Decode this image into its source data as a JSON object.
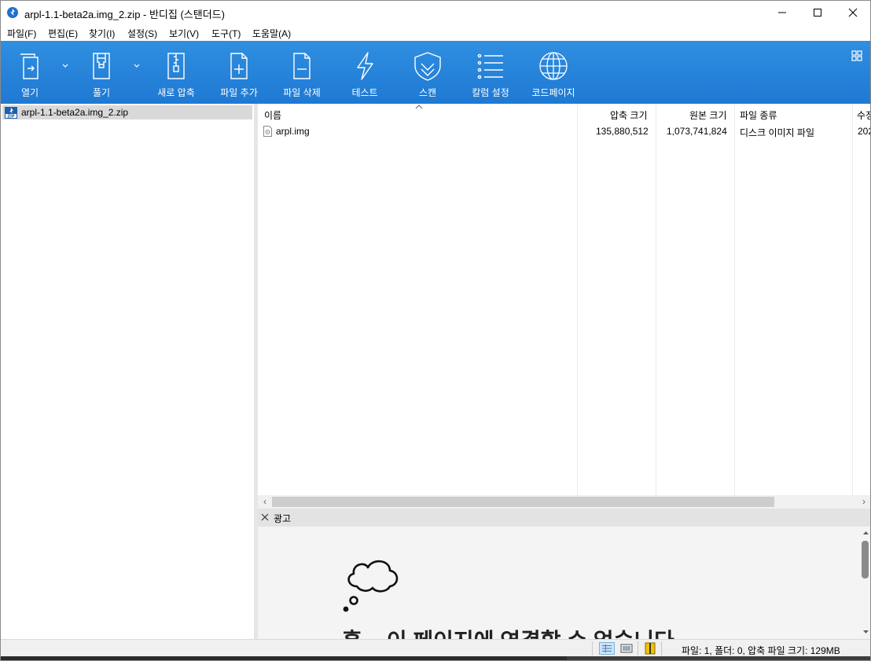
{
  "window": {
    "title": "arpl-1.1-beta2a.img_2.zip - 반디집 (스탠더드)"
  },
  "menu": [
    {
      "label": "파일(F)"
    },
    {
      "label": "편집(E)"
    },
    {
      "label": "찾기(I)"
    },
    {
      "label": "설정(S)"
    },
    {
      "label": "보기(V)"
    },
    {
      "label": "도구(T)"
    },
    {
      "label": "도움말(A)"
    }
  ],
  "toolbar": {
    "buttons": [
      {
        "label": "열기",
        "icon": "open-icon",
        "has_dropdown": true
      },
      {
        "label": "풀기",
        "icon": "extract-icon",
        "has_dropdown": true
      },
      {
        "label": "새로 압축",
        "icon": "new-archive-icon"
      },
      {
        "label": "파일 추가",
        "icon": "add-file-icon"
      },
      {
        "label": "파일 삭제",
        "icon": "delete-file-icon"
      },
      {
        "label": "테스트",
        "icon": "lightning-icon"
      },
      {
        "label": "스캔",
        "icon": "shield-icon"
      },
      {
        "label": "칼럼 설정",
        "icon": "list-icon"
      },
      {
        "label": "코드페이지",
        "icon": "globe-icon"
      }
    ],
    "accent_color": "#2a88dd"
  },
  "tree": {
    "items": [
      {
        "label": "arpl-1.1-beta2a.img_2.zip",
        "icon": "zip-icon",
        "selected": true
      }
    ]
  },
  "filelist": {
    "columns": [
      {
        "label": "이름"
      },
      {
        "label": "압축 크기"
      },
      {
        "label": "원본 크기"
      },
      {
        "label": "파일 종류"
      },
      {
        "label": "수정"
      }
    ],
    "rows": [
      {
        "name": "arpl.img",
        "packed": "135,880,512",
        "size": "1,073,741,824",
        "type": "디스크 이미지 파일",
        "modified": "202"
      }
    ]
  },
  "ad": {
    "title": "광고",
    "message": "흠... 이 페이지에 연결할 수 없습니다"
  },
  "status": {
    "text": "파일: 1, 폴더: 0, 압축 파일 크기: 129MB"
  }
}
